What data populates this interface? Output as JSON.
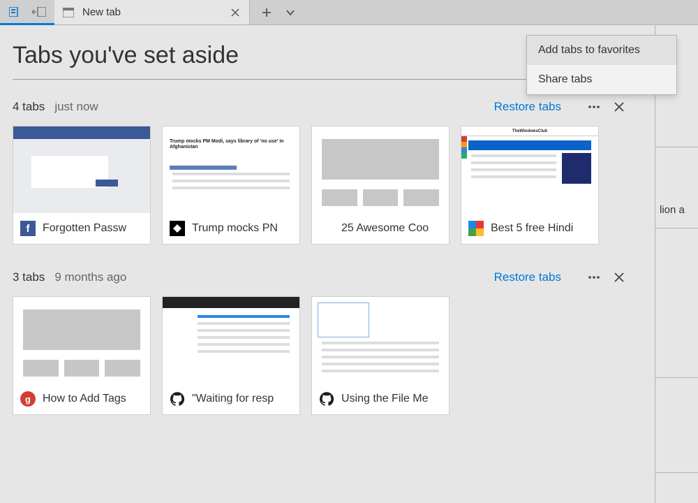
{
  "chrome": {
    "active_tab_title": "New tab"
  },
  "context_menu": {
    "items": [
      {
        "label": "Add tabs to favorites"
      },
      {
        "label": "Share tabs"
      }
    ]
  },
  "right_peek": {
    "snippet": "lion   a"
  },
  "panel": {
    "title": "Tabs you've set aside"
  },
  "groups": [
    {
      "count_label": "4 tabs",
      "when_label": "just now",
      "restore_label": "Restore tabs",
      "tiles": [
        {
          "title": "Forgotten Passw",
          "favicon": "fb"
        },
        {
          "title": "Trump mocks PN",
          "favicon": "eagle",
          "headline": "Trump mocks PM Modi, says library of 'no use' in Afghanistan"
        },
        {
          "title": "25 Awesome Coo",
          "favicon": "none"
        },
        {
          "title": "Best 5 free Hindi",
          "favicon": "play4",
          "brand": "TheWindowsClub"
        }
      ]
    },
    {
      "count_label": "3 tabs",
      "when_label": "9 months ago",
      "restore_label": "Restore tabs",
      "tiles": [
        {
          "title": "How to Add Tags",
          "favicon": "g"
        },
        {
          "title": "\"Waiting for resp",
          "favicon": "gh"
        },
        {
          "title": "Using the File Me",
          "favicon": "gh"
        }
      ]
    }
  ]
}
